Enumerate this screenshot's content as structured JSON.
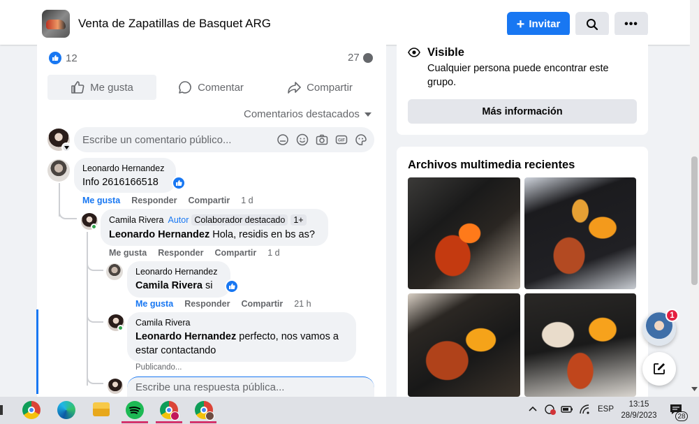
{
  "header": {
    "group_name": "Venta de Zapatillas de Basquet ARG",
    "invite_label": "Invitar"
  },
  "post": {
    "like_count": "12",
    "comment_count": "27",
    "actions": {
      "like": "Me gusta",
      "comment": "Comentar",
      "share": "Compartir"
    },
    "sort_label": "Comentarios destacados",
    "comment_placeholder": "Escribe un comentario público..."
  },
  "comments": {
    "c1": {
      "author": "Leonardo Hernandez",
      "text": "Info 2616166518",
      "like": "Me gusta",
      "reply": "Responder",
      "share": "Compartir",
      "time": "1 d"
    },
    "r1": {
      "author": "Camila Rivera",
      "author_tag": "Autor",
      "badge1": "Colaborador destacado",
      "badge2": "1+",
      "mention": "Leonardo Hernandez",
      "text": "Hola, residis en bs as?",
      "like": "Me gusta",
      "reply": "Responder",
      "share": "Compartir",
      "time": "1 d"
    },
    "r2": {
      "author": "Leonardo Hernandez",
      "mention": "Camila Rivera",
      "text": "si",
      "like": "Me gusta",
      "reply": "Responder",
      "share": "Compartir",
      "time": "21 h"
    },
    "r3": {
      "author": "Camila Rivera",
      "mention": "Leonardo Hernandez",
      "text": "perfecto, nos vamos a estar contactando",
      "status": "Publicando..."
    },
    "reply_placeholder": "Escribe una respuesta pública..."
  },
  "sidebar": {
    "visibility_title": "Visible",
    "visibility_desc": "Cualquier persona puede encontrar este grupo.",
    "more_info": "Más información",
    "media_title": "Archivos multimedia recientes"
  },
  "chat": {
    "notification_count": "1"
  },
  "taskbar": {
    "language": "ESP",
    "time": "13:15",
    "date": "28/9/2023",
    "notifications": "28"
  },
  "colors": {
    "accent": "#1877f2",
    "online": "#31a24c",
    "badge_red": "#e41e3f"
  }
}
